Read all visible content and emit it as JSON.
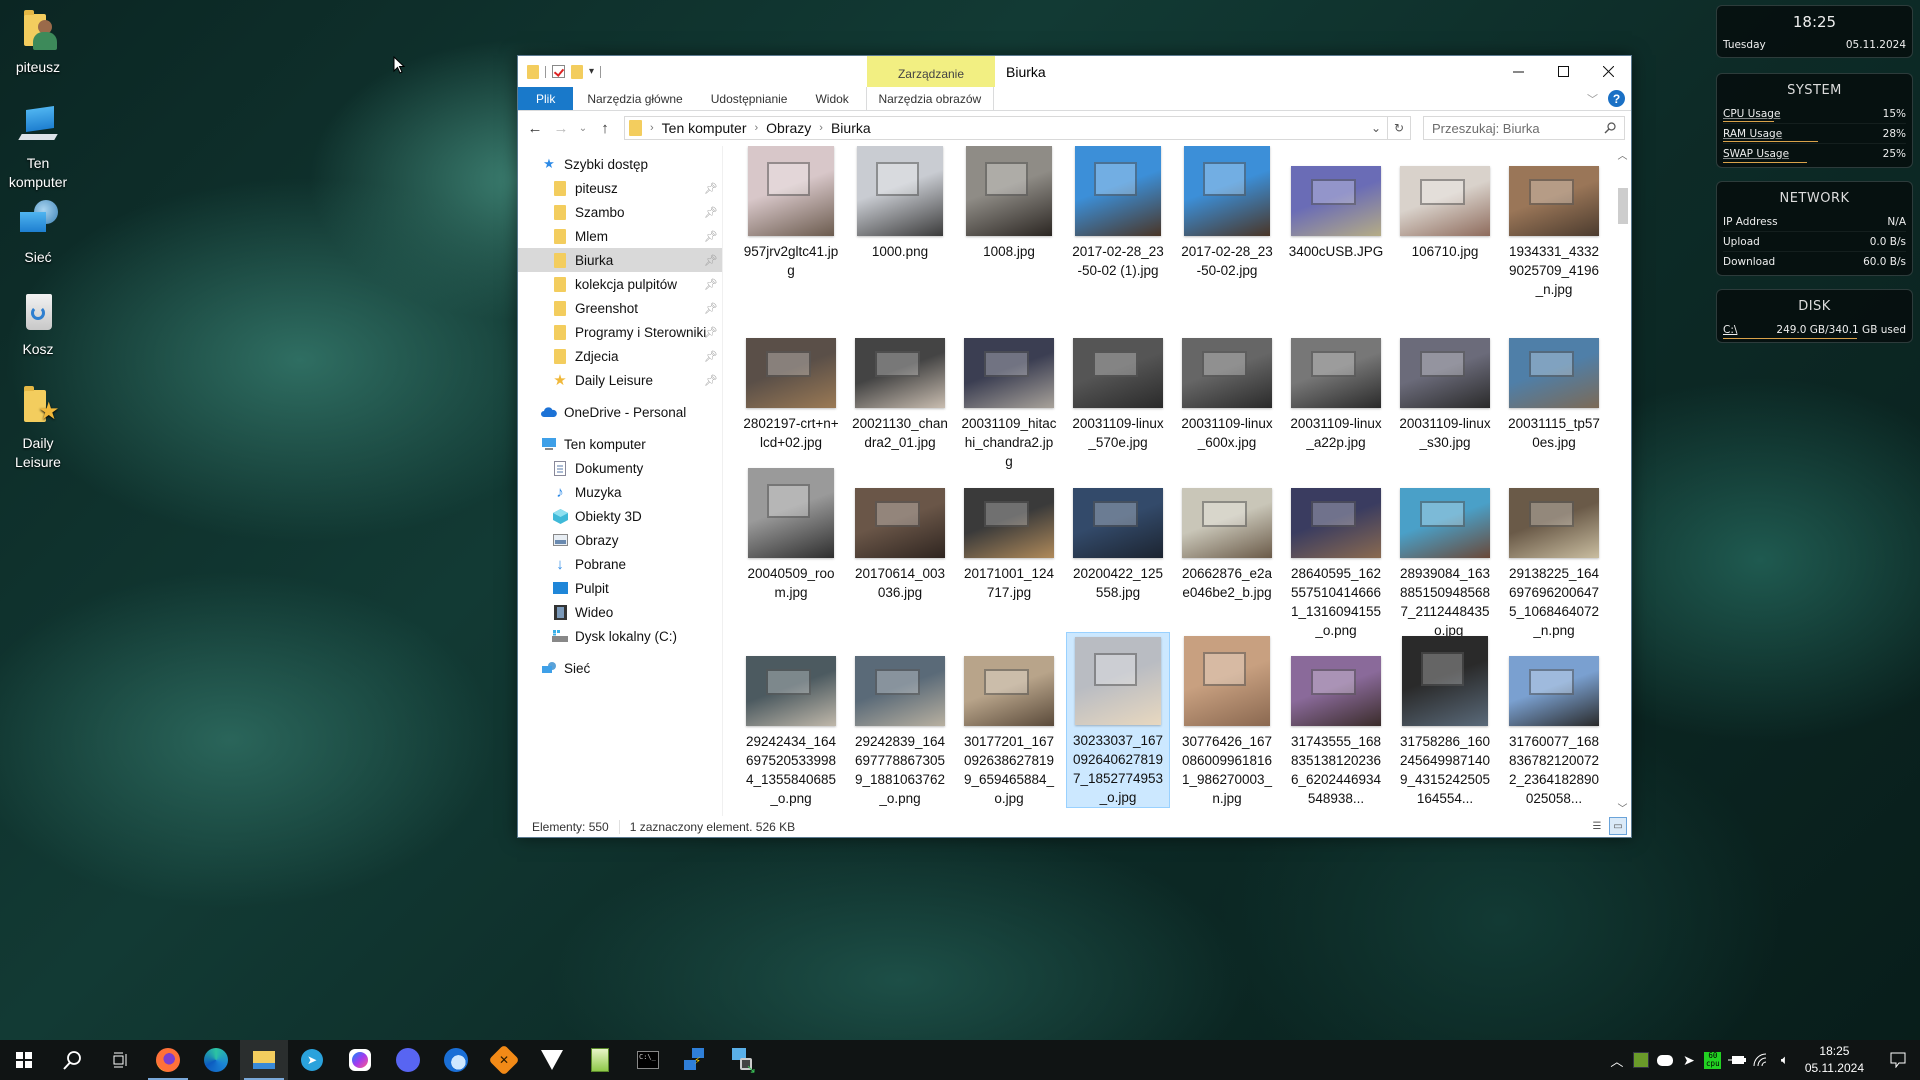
{
  "desktop": {
    "icons": [
      {
        "label": "piteusz",
        "icon": "user-folder-icon"
      },
      {
        "label": "Ten komputer",
        "icon": "computer-icon"
      },
      {
        "label": "Sieć",
        "icon": "network-icon"
      },
      {
        "label": "Kosz",
        "icon": "recycle-bin-icon"
      },
      {
        "label": "Daily Leisure",
        "icon": "starred-folder-icon"
      }
    ]
  },
  "explorer": {
    "title": "Biurka",
    "context_tab_header": "Zarządzanie",
    "ribbon_tabs": [
      {
        "label": "Plik"
      },
      {
        "label": "Narzędzia główne"
      },
      {
        "label": "Udostępnianie"
      },
      {
        "label": "Widok"
      },
      {
        "label": "Narzędzia obrazów"
      }
    ],
    "breadcrumb": [
      "Ten komputer",
      "Obrazy",
      "Biurka"
    ],
    "search_placeholder": "Przeszukaj: Biurka",
    "nav": {
      "quick_access": "Szybki dostęp",
      "pinned": [
        {
          "label": "piteusz"
        },
        {
          "label": "Szambo"
        },
        {
          "label": "Mlem"
        },
        {
          "label": "Biurka",
          "selected": true
        },
        {
          "label": "kolekcja pulpitów"
        },
        {
          "label": "Greenshot"
        },
        {
          "label": "Programy i Sterowniki"
        },
        {
          "label": "Zdjecia"
        },
        {
          "label": "Daily Leisure"
        }
      ],
      "onedrive": "OneDrive - Personal",
      "this_pc": "Ten komputer",
      "pc_items": [
        {
          "label": "Dokumenty",
          "icon": "documents-icon"
        },
        {
          "label": "Muzyka",
          "icon": "music-icon"
        },
        {
          "label": "Obiekty 3D",
          "icon": "3d-objects-icon"
        },
        {
          "label": "Obrazy",
          "icon": "pictures-icon"
        },
        {
          "label": "Pobrane",
          "icon": "downloads-icon"
        },
        {
          "label": "Pulpit",
          "icon": "desktop-icon"
        },
        {
          "label": "Wideo",
          "icon": "video-icon"
        },
        {
          "label": "Dysk lokalny (C:)",
          "icon": "drive-icon"
        }
      ],
      "network": "Sieć"
    },
    "files": [
      {
        "name": "957jrv2gltc41.jpg",
        "tone": [
          "#d8c7c9",
          "#6b5b4e"
        ],
        "portrait": true
      },
      {
        "name": "1000.png",
        "tone": [
          "#c9ccd2",
          "#3b3b3b"
        ],
        "portrait": true
      },
      {
        "name": "1008.jpg",
        "tone": [
          "#8f8c86",
          "#2b2622"
        ],
        "portrait": true
      },
      {
        "name": "2017-02-28_23-50-02 (1).jpg",
        "tone": [
          "#3c8fd8",
          "#4a3526"
        ],
        "portrait": true
      },
      {
        "name": "2017-02-28_23-50-02.jpg",
        "tone": [
          "#3c8fd8",
          "#4a3526"
        ],
        "portrait": true
      },
      {
        "name": "3400cUSB.JPG",
        "tone": [
          "#6a6cb6",
          "#b5ac85"
        ],
        "portrait": false
      },
      {
        "name": "106710.jpg",
        "tone": [
          "#d9d2cb",
          "#8e6b5c"
        ],
        "portrait": false
      },
      {
        "name": "1934331_43329025709_4196_n.jpg",
        "tone": [
          "#9a7658",
          "#4b3b2e"
        ],
        "portrait": false
      },
      {
        "name": "2802197-crt+n+lcd+02.jpg",
        "tone": [
          "#5a4f48",
          "#9b7a55"
        ],
        "portrait": false
      },
      {
        "name": "20021130_chandra2_01.jpg",
        "tone": [
          "#444",
          "#c9bdb0"
        ],
        "portrait": false
      },
      {
        "name": "20031109_hitachi_chandra2.jpg",
        "tone": [
          "#3b3e52",
          "#a8a29a"
        ],
        "portrait": false
      },
      {
        "name": "20031109-linux_570e.jpg",
        "tone": [
          "#555",
          "#2a2a2a"
        ],
        "portrait": false
      },
      {
        "name": "20031109-linux_600x.jpg",
        "tone": [
          "#666",
          "#2a2a2a"
        ],
        "portrait": false
      },
      {
        "name": "20031109-linux_a22p.jpg",
        "tone": [
          "#777",
          "#2a2a2a"
        ],
        "portrait": false
      },
      {
        "name": "20031109-linux_s30.jpg",
        "tone": [
          "#6b6b7a",
          "#2a2a2a"
        ],
        "portrait": false
      },
      {
        "name": "20031115_tp570es.jpg",
        "tone": [
          "#4f7fa8",
          "#7c6a56"
        ],
        "portrait": false
      },
      {
        "name": "20040509_room.jpg",
        "tone": [
          "#9a9a9a",
          "#2e2e2e"
        ],
        "portrait": true
      },
      {
        "name": "20170614_003036.jpg",
        "tone": [
          "#6a5648",
          "#2f2520"
        ],
        "portrait": false
      },
      {
        "name": "20171001_124717.jpg",
        "tone": [
          "#3a3a3a",
          "#b08a5a"
        ],
        "portrait": false
      },
      {
        "name": "20200422_125558.jpg",
        "tone": [
          "#334a6a",
          "#1c2430"
        ],
        "portrait": false
      },
      {
        "name": "20662876_e2ae046be2_b.jpg",
        "tone": [
          "#c9c6b8",
          "#6a5a48"
        ],
        "portrait": false
      },
      {
        "name": "28640595_1625575104146661_1316094155_o.png",
        "tone": [
          "#3a3c60",
          "#8a6a50"
        ],
        "portrait": false
      },
      {
        "name": "28939084_1638851509485687_2112448435_o.jpg",
        "tone": [
          "#4aa0c8",
          "#6a4838"
        ],
        "portrait": false
      },
      {
        "name": "29138225_1646976962006475_1068464072_n.png",
        "tone": [
          "#6a5a48",
          "#c9bda0"
        ],
        "portrait": false
      },
      {
        "name": "29242434_1646975205339984_1355840685_o.png",
        "tone": [
          "#4c5a60",
          "#c0b8aa"
        ],
        "portrait": false
      },
      {
        "name": "29242839_1646977788673059_1881063762_o.png",
        "tone": [
          "#5a6a78",
          "#b8b0a0"
        ],
        "portrait": false
      },
      {
        "name": "30177201_1670926386278199_659465884_o.jpg",
        "tone": [
          "#b8a48a",
          "#5a4a3a"
        ],
        "portrait": false
      },
      {
        "name": "30233037_1670926406278197_1852774953_o.jpg",
        "tone": [
          "#b9bcc2",
          "#e8d8c0"
        ],
        "portrait": true,
        "selected": true
      },
      {
        "name": "30776426_1670860099618161_986270003_n.jpg",
        "tone": [
          "#c8a080",
          "#8a6850"
        ],
        "portrait": true
      },
      {
        "name": "31743555_1688351381202366_6202446934548938...",
        "tone": [
          "#8a6a9a",
          "#3a2c2a"
        ],
        "portrait": false
      },
      {
        "name": "31758286_1602456499871409_4315242505164554...",
        "tone": [
          "#2a2a2a",
          "#5a6a7a"
        ],
        "portrait": true
      },
      {
        "name": "31760077_1688367821200722_2364182890025058...",
        "tone": [
          "#7aa0d0",
          "#2a2a2a"
        ],
        "portrait": false
      }
    ],
    "status": {
      "count": "Elementy: 550",
      "selection": "1 zaznaczony element. 526 KB"
    }
  },
  "widget": {
    "time": "18:25",
    "day": "Tuesday",
    "date": "05.11.2024",
    "system": {
      "title": "SYSTEM",
      "rows": [
        {
          "label": "CPU Usage",
          "value": "15%",
          "fraction": 0.15
        },
        {
          "label": "RAM Usage",
          "value": "28%",
          "fraction": 0.28
        },
        {
          "label": "SWAP Usage",
          "value": "25%",
          "fraction": 0.25
        }
      ]
    },
    "network": {
      "title": "NETWORK",
      "rows": [
        {
          "label": "IP Address",
          "value": "N/A"
        },
        {
          "label": "Upload",
          "value": "0.0 B/s"
        },
        {
          "label": "Download",
          "value": "60.0 B/s"
        }
      ]
    },
    "disk": {
      "title": "DISK",
      "label": "C:\\",
      "value": "249.0 GB/340.1 GB used",
      "fraction": 0.732
    },
    "accent": "#d9a24a"
  },
  "taskbar": {
    "apps": [
      {
        "name": "start"
      },
      {
        "name": "search"
      },
      {
        "name": "task-view"
      },
      {
        "name": "firefox",
        "running": true
      },
      {
        "name": "edge"
      },
      {
        "name": "file-explorer",
        "running": true,
        "active": true
      },
      {
        "name": "telegram"
      },
      {
        "name": "messenger"
      },
      {
        "name": "discord"
      },
      {
        "name": "thunderbird"
      },
      {
        "name": "app-x"
      },
      {
        "name": "foobar"
      },
      {
        "name": "notepad-plus"
      },
      {
        "name": "terminal"
      },
      {
        "name": "remote-desktop"
      },
      {
        "name": "network-lock"
      }
    ],
    "tray": {
      "cpu_badge_top": "60",
      "cpu_badge_bottom": "cpu",
      "time": "18:25",
      "date": "05.11.2024"
    }
  }
}
